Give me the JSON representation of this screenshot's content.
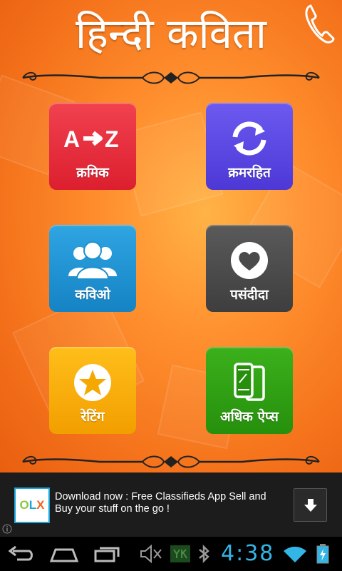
{
  "app": {
    "title": "हिन्दी कविता",
    "tiles": [
      {
        "id": "kramik",
        "label": "क्रमिक",
        "icon": "a-to-z-icon",
        "color": "#e8283a"
      },
      {
        "id": "kramrahit",
        "label": "क्रमरहित",
        "icon": "shuffle-refresh-icon",
        "color": "#5b45e0"
      },
      {
        "id": "kavio",
        "label": "कविओ",
        "icon": "people-group-icon",
        "color": "#1d8fcf"
      },
      {
        "id": "pasandida",
        "label": "पसंदीदा",
        "icon": "heart-icon",
        "color": "#4a4a4a"
      },
      {
        "id": "rating",
        "label": "रेटिंग",
        "icon": "star-icon",
        "color": "#f5a800"
      },
      {
        "id": "more-apps",
        "label": "अधिक ऐप्स",
        "icon": "phones-icon",
        "color": "#2e9b12"
      }
    ],
    "az_text": {
      "a": "A",
      "z": "Z"
    }
  },
  "ad": {
    "logo_text": {
      "o": "O",
      "l": "L",
      "x": "X"
    },
    "text": "Download now : Free Classifieds App Sell and Buy your stuff on the go !",
    "download_icon": "download-arrow-icon",
    "info_icon": "info-icon"
  },
  "navbar": {
    "back_icon": "back-icon",
    "home_icon": "home-icon",
    "recents_icon": "recent-apps-icon",
    "time": "4:38"
  },
  "colors": {
    "accent_clock": "#33b5e5",
    "background": "#f37a20"
  }
}
